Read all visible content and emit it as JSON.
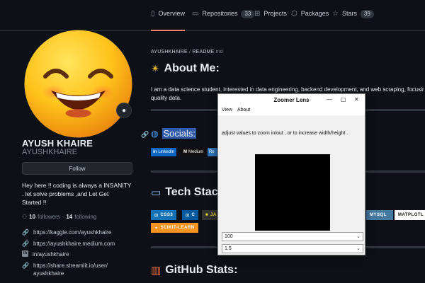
{
  "tabs": [
    {
      "icon": "book-icon",
      "glyph": "▯",
      "label": "Overview"
    },
    {
      "icon": "repo-icon",
      "glyph": "▭",
      "label": "Repositories",
      "count": "33"
    },
    {
      "icon": "table-icon",
      "glyph": "⊞",
      "label": "Projects"
    },
    {
      "icon": "package-icon",
      "glyph": "⬡",
      "label": "Packages"
    },
    {
      "icon": "star-icon",
      "glyph": "☆",
      "label": "Stars",
      "count": "39"
    }
  ],
  "profile": {
    "name": "AYUSH KHAIRE",
    "login": "AYUSHKHAIRE",
    "follow_label": "Follow",
    "bio_lines": [
      "Hey here !! coding is always a INSANITY",
      ". let solve problems ,and Let Get",
      "Started !!"
    ],
    "followers_count": "10",
    "followers_label": "followers",
    "sep": "·",
    "following_count": "14",
    "following_label": "following",
    "links": {
      "kaggle": "https://kaggle.com/ayushkhaire",
      "medium": "https://ayushkhaire.medium.com",
      "linkedin": "in/ayushkhaire",
      "streamlit_1": "https://share.streamlit.io/user/",
      "streamlit_2": "ayushkhaire"
    }
  },
  "readme": {
    "breadcrumb_user": "AYUSHKHAIRE",
    "breadcrumb_sep": "/",
    "breadcrumb_file": "README",
    "breadcrumb_ext": ".md",
    "about_title": "About Me:",
    "about_line1": "I am a data science student, interested in data engineering, backend development, and web scraping, focusing on",
    "about_line2": "quality data.",
    "socials_title": "Socials:",
    "social_badges": {
      "linkedin": "LinkedIn",
      "medium": "Medium",
      "partial": "Re"
    },
    "tech_title": "Tech Stack",
    "tech_badges": {
      "css": "CSS3",
      "c": "C",
      "ja": "JA",
      "mysql": "MYSQL",
      "matplotlib": "MATPLOTL",
      "sklearn": "SCIKIT-LEARN"
    },
    "stats_title": "GitHub Stats:"
  },
  "zoomer": {
    "title": "Zoomer Lens",
    "minimize": "—",
    "maximize": "▢",
    "close": "✕",
    "menu": [
      "View",
      "About"
    ],
    "instruction": "adjust values to zoom in/out , or to increase width/height .",
    "zoom_value": "100",
    "scale_value": "1.5",
    "arrow": "⌄"
  }
}
